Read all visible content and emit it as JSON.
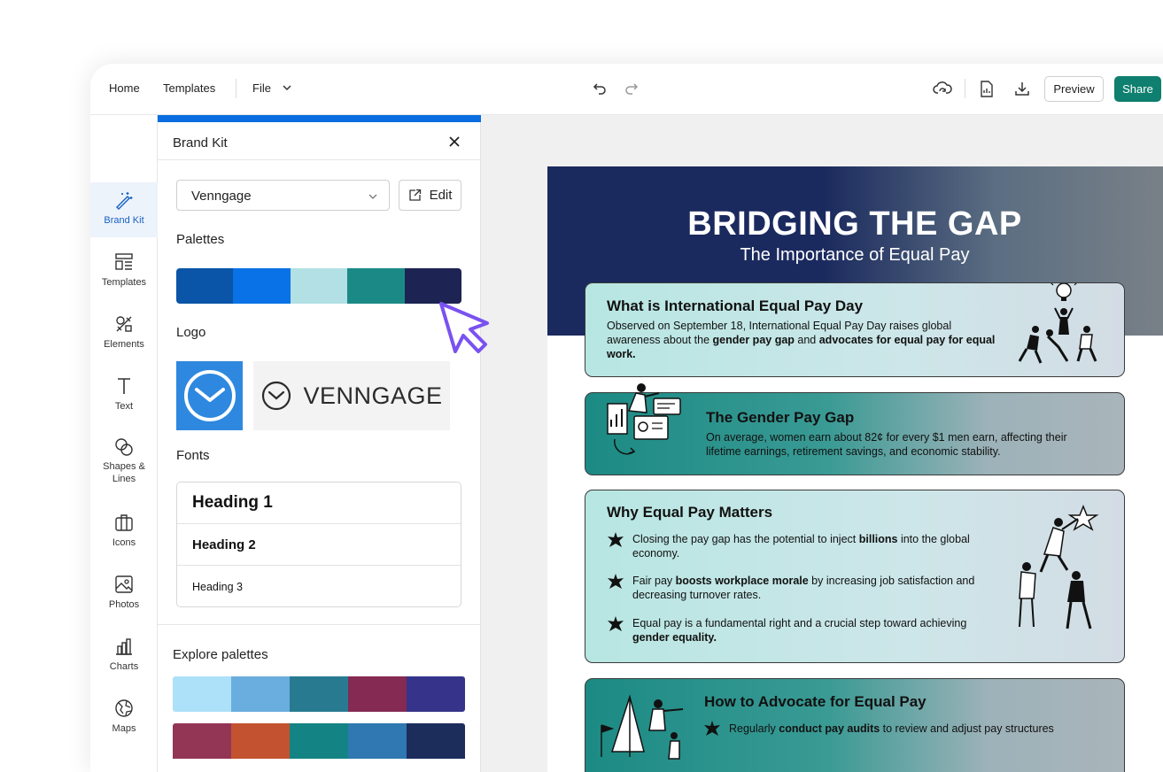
{
  "topbar": {
    "nav": {
      "home": "Home",
      "templates": "Templates",
      "file": "File"
    },
    "preview_label": "Preview",
    "share_label": "Share",
    "icons": [
      "undo-icon",
      "redo-icon",
      "cloud-sync-icon",
      "document-icon",
      "download-icon"
    ],
    "share_color": "#0f7f6f"
  },
  "rail": {
    "items": [
      {
        "label": "Brand Kit",
        "icon": "magic-wand-icon",
        "active": true
      },
      {
        "label": "Templates",
        "icon": "templates-icon"
      },
      {
        "label": "Elements",
        "icon": "elements-icon"
      },
      {
        "label": "Text",
        "icon": "text-icon"
      },
      {
        "label": "Shapes & Lines",
        "icon": "shapes-icon"
      },
      {
        "label": "Icons",
        "icon": "icons-icon"
      },
      {
        "label": "Photos",
        "icon": "photos-icon"
      },
      {
        "label": "Charts",
        "icon": "charts-icon"
      },
      {
        "label": "Maps",
        "icon": "maps-icon"
      }
    ]
  },
  "panel": {
    "title": "Brand Kit",
    "brand_select": "Venngage",
    "edit_label": "Edit",
    "palettes_label": "Palettes",
    "palette": [
      "#0a55a8",
      "#0872e6",
      "#b2e0e5",
      "#1b8a87",
      "#1d2352"
    ],
    "logo_label": "Logo",
    "logo_wordmark": "VENNGAGE",
    "fonts_label": "Fonts",
    "fonts": [
      "Heading 1",
      "Heading 2",
      "Heading 3"
    ],
    "explore_label": "Explore palettes",
    "explore_palettes": [
      [
        "#ade0f9",
        "#6aaddf",
        "#287a91",
        "#842a53",
        "#35348a"
      ],
      [
        "#933656",
        "#c35330",
        "#148384",
        "#2f78b1",
        "#1c2d5c"
      ]
    ]
  },
  "doc": {
    "title": "BRIDGING THE GAP",
    "subtitle": "The Importance of Equal Pay",
    "card1": {
      "heading": "What is International Equal Pay Day",
      "t1": "Observed on September 18, International Equal Pay Day raises global awareness about the ",
      "b1": "gender pay gap",
      "t2": " and ",
      "b2": "advocates for equal pay for equal work."
    },
    "card2": {
      "heading": "The Gender Pay Gap",
      "text": "On average, women earn about 82¢ for every $1 men earn, affecting their lifetime earnings, retirement savings, and economic stability."
    },
    "card3": {
      "heading": "Why Equal Pay Matters",
      "bullets": [
        {
          "a": "Closing the pay gap has the potential to inject ",
          "b": "billions",
          "c": " into the global economy."
        },
        {
          "a": "Fair pay ",
          "b": "boosts workplace morale",
          "c": " by increasing job satisfaction and decreasing turnover rates."
        },
        {
          "a": "Equal pay is a fundamental right and a crucial step toward achieving ",
          "b": "gender equality.",
          "c": ""
        }
      ]
    },
    "card4": {
      "heading": "How to Advocate for Equal Pay",
      "bullet": {
        "a": "Regularly ",
        "b": "conduct pay audits",
        "c": " to review and adjust pay structures"
      }
    }
  }
}
